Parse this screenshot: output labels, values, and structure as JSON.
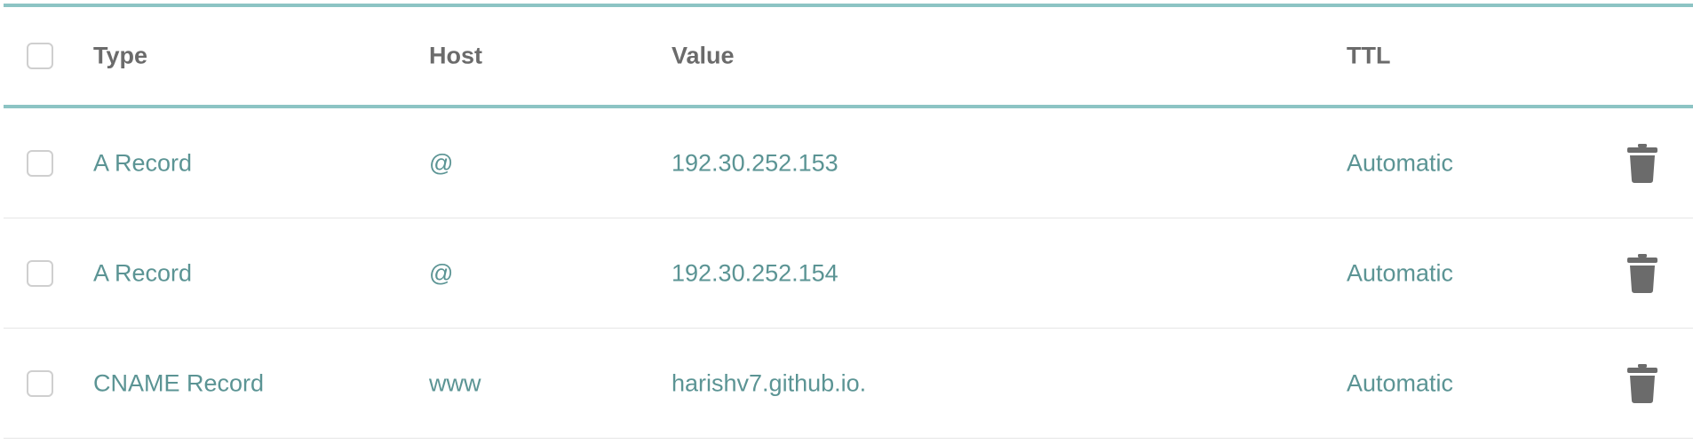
{
  "table": {
    "headers": {
      "type": "Type",
      "host": "Host",
      "value": "Value",
      "ttl": "TTL"
    },
    "rows": [
      {
        "type": "A Record",
        "host": "@",
        "value": "192.30.252.153",
        "ttl": "Automatic"
      },
      {
        "type": "A Record",
        "host": "@",
        "value": "192.30.252.154",
        "ttl": "Automatic"
      },
      {
        "type": "CNAME Record",
        "host": "www",
        "value": "harishv7.github.io.",
        "ttl": "Automatic"
      }
    ]
  },
  "colors": {
    "header_border": "#8cc4c4",
    "header_text": "#6b6b6b",
    "cell_text": "#5b9494",
    "trash_icon": "#6b6b6b"
  },
  "icons": {
    "delete": "trash-icon"
  }
}
